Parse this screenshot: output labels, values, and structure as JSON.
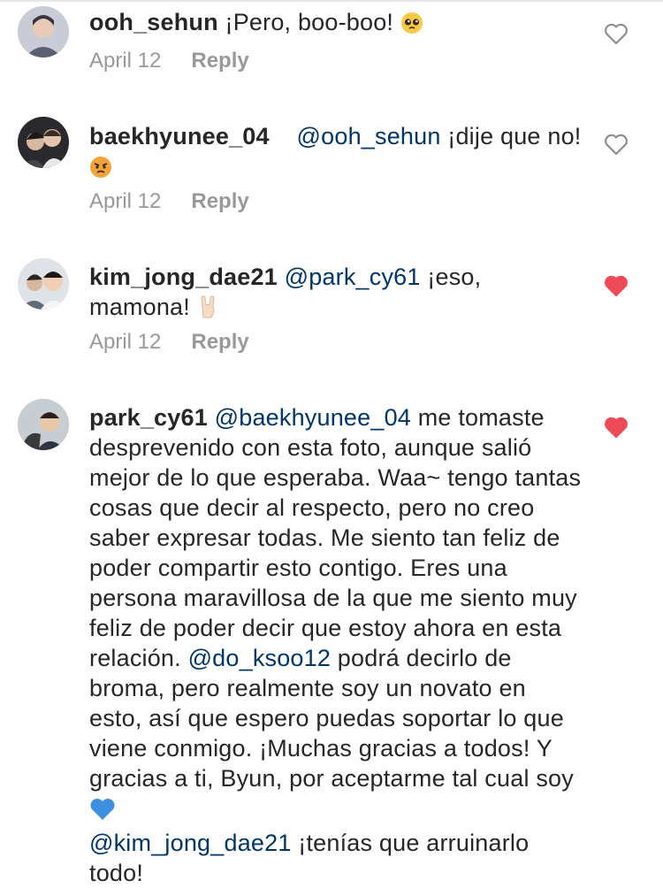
{
  "comments": [
    {
      "username": "ooh_sehun",
      "text": " ¡Pero, boo-boo! ",
      "emoji": "pleading-face",
      "date": "April 12",
      "reply": "Reply",
      "liked": false
    },
    {
      "username": "baekhyunee_04",
      "mention": "@ooh_sehun",
      "text": " ¡dije que no! ",
      "emoji": "angry-face",
      "date": "April 12",
      "reply": "Reply",
      "liked": false
    },
    {
      "username": "kim_jong_dae21",
      "mention": "@park_cy61",
      "text": " ¡eso, mamona! ",
      "emoji": "rock-on-hand",
      "date": "April 12",
      "reply": "Reply",
      "liked": true
    },
    {
      "username": "park_cy61",
      "mention": "@baekhyunee_04",
      "text1": " me tomaste desprevenido con esta foto, aunque salió mejor de lo que esperaba. Waa~ tengo tantas cosas que decir al respecto, pero no creo saber expresar todas. Me siento tan feliz de poder compartir esto contigo. Eres una persona maravillosa de la que me siento muy feliz de poder decir que estoy ahora en esta relación. ",
      "mention2": "@do_ksoo12",
      "text2": " podrá decirlo de broma, pero realmente soy un novato en esto, así que espero puedas soportar lo que viene conmigo. ¡Muchas gracias a todos! Y gracias a ti, Byun, por aceptarme tal cual soy ",
      "emoji": "blue-heart",
      "mention3": "@kim_jong_dae21",
      "text3": " ¡tenías que arruinarlo todo!",
      "liked": true
    }
  ],
  "colors": {
    "text": "#262626",
    "mention": "#003569",
    "meta": "#999999",
    "liked_heart": "#ed4956"
  }
}
